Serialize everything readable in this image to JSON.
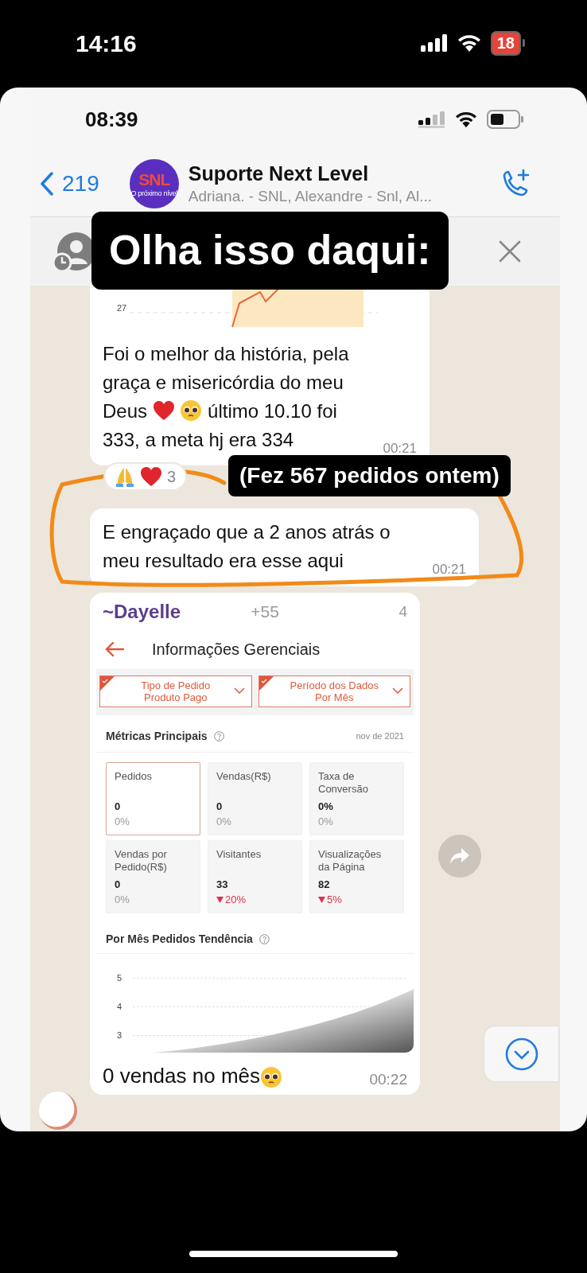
{
  "status_bar": {
    "time": "14:16",
    "battery": "18"
  },
  "inner_status_bar": {
    "time": "08:39"
  },
  "chat_header": {
    "back_count": "219",
    "avatar_logo": "SNL",
    "avatar_tagline": "O próximo nível",
    "title": "Suporte Next Level",
    "subtitle": "Adriana. - SNL, Alexandre - Snl, Al..."
  },
  "story_labels": [
    {
      "text": "Olha isso daqui:",
      "kind": "large"
    },
    {
      "text": "(Fez 567 pedidos ontem)",
      "kind": "small"
    }
  ],
  "messages": [
    {
      "kind": "chart",
      "chart_tick": "27",
      "lines": [
        [
          {
            "kind": "text",
            "text": "Foi o melhor da história, pela"
          }
        ],
        [
          {
            "kind": "text",
            "text": "graça e misericórdia do meu"
          }
        ],
        [
          {
            "kind": "text",
            "text": "Deus"
          },
          {
            "kind": "heart"
          },
          {
            "kind": "plead"
          },
          {
            "kind": "text",
            "text": "último 10.10 foi"
          }
        ],
        [
          {
            "kind": "text",
            "text": "333, a meta hj era 334"
          }
        ]
      ],
      "time": "00:21",
      "reactions": {
        "count": "3"
      }
    },
    {
      "kind": "text",
      "lines": [
        [
          {
            "kind": "text",
            "text": "E engraçado que a 2 anos atrás o"
          }
        ],
        [
          {
            "kind": "text",
            "text": "meu resultado era esse aqui"
          }
        ]
      ],
      "time": "00:21",
      "circled": true
    },
    {
      "kind": "screenshot",
      "sender": "~Dayelle",
      "phone": "+55",
      "column_3": "4",
      "screen": {
        "title": "Informações Gerenciais",
        "filters": [
          {
            "label": "Tipo de Pedido",
            "value": "Produto Pago",
            "checked": true
          },
          {
            "label": "Período dos Dados",
            "value": "Por Mês",
            "checked": true
          }
        ],
        "metrics_title": "Métricas Principais",
        "period": "nov de 2021",
        "metrics": [
          {
            "label": "Pedidos",
            "value": "0",
            "change": "0%",
            "kind": "flat",
            "selected": true
          },
          {
            "label": "Vendas(R$)",
            "value": "0",
            "change": "0%",
            "kind": "flat",
            "selected": false
          },
          {
            "label": "Taxa de Conversão",
            "value": "0%",
            "change": "0%",
            "kind": "flat",
            "selected": false
          },
          {
            "label": "Vendas por Pedido(R$)",
            "value": "0",
            "change": "0%",
            "kind": "flat",
            "selected": false
          },
          {
            "label": "Visitantes",
            "value": "33",
            "change": "20%",
            "kind": "down",
            "selected": false
          },
          {
            "label": "Visualizações da Página",
            "value": "82",
            "change": "5%",
            "kind": "down",
            "selected": false
          }
        ],
        "trend_title": "Por Mês Pedidos Tendência",
        "trend_ticks": [
          "5",
          "4",
          "3"
        ]
      },
      "segments": [
        {
          "kind": "text",
          "text": "0 vendas no mês"
        },
        {
          "kind": "plead"
        }
      ],
      "time": "00:22"
    }
  ]
}
